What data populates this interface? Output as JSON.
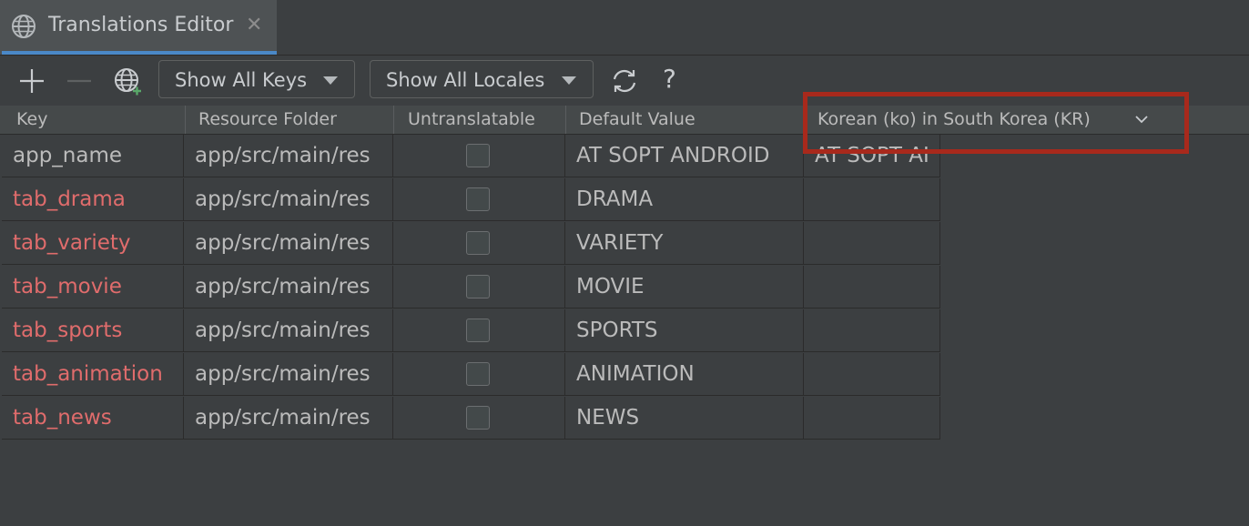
{
  "tab": {
    "title": "Translations Editor",
    "close_glyph": "✕"
  },
  "toolbar": {
    "add_icon": "plus-icon",
    "remove_icon": "minus-icon",
    "locale_icon": "globe-icon",
    "keys_filter": "Show All Keys",
    "locales_filter": "Show All Locales",
    "reload_icon": "reload-icon",
    "help_glyph": "?"
  },
  "columns": {
    "key": "Key",
    "folder": "Resource Folder",
    "untranslatable": "Untranslatable",
    "default": "Default Value",
    "locale": "Korean (ko) in South Korea (KR)"
  },
  "rows": [
    {
      "key": "app_name",
      "folder": "app/src/main/res",
      "default": "AT SOPT ANDROID",
      "locale": "AT SOPT AI"
    },
    {
      "key": "tab_drama",
      "folder": "app/src/main/res",
      "default": "DRAMA",
      "locale": ""
    },
    {
      "key": "tab_variety",
      "folder": "app/src/main/res",
      "default": "VARIETY",
      "locale": ""
    },
    {
      "key": "tab_movie",
      "folder": "app/src/main/res",
      "default": "MOVIE",
      "locale": ""
    },
    {
      "key": "tab_sports",
      "folder": "app/src/main/res",
      "default": "SPORTS",
      "locale": ""
    },
    {
      "key": "tab_animation",
      "folder": "app/src/main/res",
      "default": "ANIMATION",
      "locale": ""
    },
    {
      "key": "tab_news",
      "folder": "app/src/main/res",
      "default": "NEWS",
      "locale": ""
    }
  ],
  "colors": {
    "missing_key": "#e06c6c",
    "highlight": "#a8291c",
    "tab_accent": "#4a88c7"
  }
}
